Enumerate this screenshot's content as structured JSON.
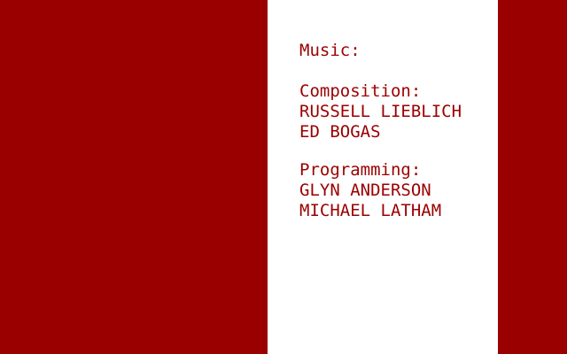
{
  "colors": {
    "background": "#9a0000",
    "panel": "#ffffff",
    "text": "#9a0000"
  },
  "credits": {
    "heading": "Music:",
    "composition": {
      "label": "Composition:",
      "names": [
        "RUSSELL LIEBLICH",
        "ED BOGAS"
      ]
    },
    "programming": {
      "label": "Programming:",
      "names": [
        "GLYN ANDERSON",
        "MICHAEL LATHAM"
      ]
    }
  }
}
